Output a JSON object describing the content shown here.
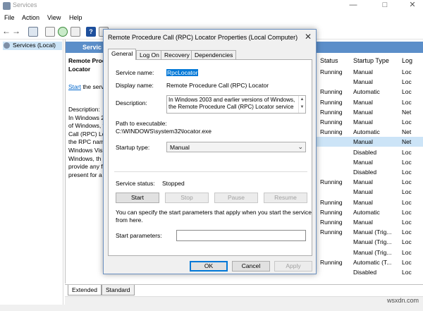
{
  "window": {
    "title": "Services"
  },
  "menu": {
    "items": [
      "File",
      "Action",
      "View",
      "Help"
    ]
  },
  "tree": {
    "root_label": "Services (Local)"
  },
  "detail": {
    "header_label": "Servic",
    "desc_title_lines": [
      "Remote Proce",
      "Locator"
    ],
    "start_link": "Start",
    "start_rest": " the serv",
    "desc_body_lines": [
      "Description:",
      "In Windows 2",
      "of Windows, t",
      "Call (RPC) Lo",
      "the RPC nam",
      "Windows Vis",
      "Windows, th",
      "provide any f",
      "present for a"
    ]
  },
  "columns": {
    "status": "Status",
    "startup_type": "Startup Type",
    "log_on": "Log"
  },
  "rows": [
    {
      "status": "Running",
      "startup": "Manual",
      "log": "Loc"
    },
    {
      "status": "",
      "startup": "Manual",
      "log": "Loc"
    },
    {
      "status": "Running",
      "startup": "Automatic",
      "log": "Loc"
    },
    {
      "status": "Running",
      "startup": "Manual",
      "log": "Loc"
    },
    {
      "status": "Running",
      "startup": "Manual",
      "log": "Net"
    },
    {
      "status": "Running",
      "startup": "Manual",
      "log": "Loc"
    },
    {
      "status": "Running",
      "startup": "Automatic",
      "log": "Net"
    },
    {
      "status": "",
      "startup": "Manual",
      "log": "Net"
    },
    {
      "status": "",
      "startup": "Disabled",
      "log": "Loc"
    },
    {
      "status": "",
      "startup": "Manual",
      "log": "Loc"
    },
    {
      "status": "",
      "startup": "Disabled",
      "log": "Loc"
    },
    {
      "status": "Running",
      "startup": "Manual",
      "log": "Loc"
    },
    {
      "status": "",
      "startup": "Manual",
      "log": "Loc"
    },
    {
      "status": "Running",
      "startup": "Manual",
      "log": "Loc"
    },
    {
      "status": "Running",
      "startup": "Automatic",
      "log": "Loc"
    },
    {
      "status": "Running",
      "startup": "Manual",
      "log": "Loc"
    },
    {
      "status": "Running",
      "startup": "Manual (Trig...",
      "log": "Loc"
    },
    {
      "status": "",
      "startup": "Manual (Trig...",
      "log": "Loc"
    },
    {
      "status": "",
      "startup": "Manual (Trig...",
      "log": "Loc"
    },
    {
      "status": "Running",
      "startup": "Automatic (T...",
      "log": "Loc"
    },
    {
      "status": "",
      "startup": "Disabled",
      "log": "Loc"
    }
  ],
  "bottom_tabs": [
    "Extended",
    "Standard"
  ],
  "watermark": "wsxdn.com",
  "dialog": {
    "title": "Remote Procedure Call (RPC) Locator Properties (Local Computer)",
    "close": "✕",
    "tabs": [
      "General",
      "Log On",
      "Recovery",
      "Dependencies"
    ],
    "service_name_label": "Service name:",
    "service_name": "RpcLocator",
    "display_name_label": "Display name:",
    "display_name": "Remote Procedure Call (RPC) Locator",
    "description_label": "Description:",
    "description_lines": [
      "In Windows 2003 and earlier versions of Windows,",
      "the Remote Procedure Call (RPC) Locator service"
    ],
    "path_label": "Path to executable:",
    "path": "C:\\WINDOWS\\system32\\locator.exe",
    "startup_label": "Startup type:",
    "startup_value": "Manual",
    "status_label": "Service status:",
    "status_value": "Stopped",
    "buttons": {
      "start": "Start",
      "stop": "Stop",
      "pause": "Pause",
      "resume": "Resume"
    },
    "info_lines": [
      "You can specify the start parameters that apply when you start the service",
      "from here."
    ],
    "params_label": "Start parameters:",
    "ok": "OK",
    "cancel": "Cancel",
    "apply": "Apply"
  }
}
